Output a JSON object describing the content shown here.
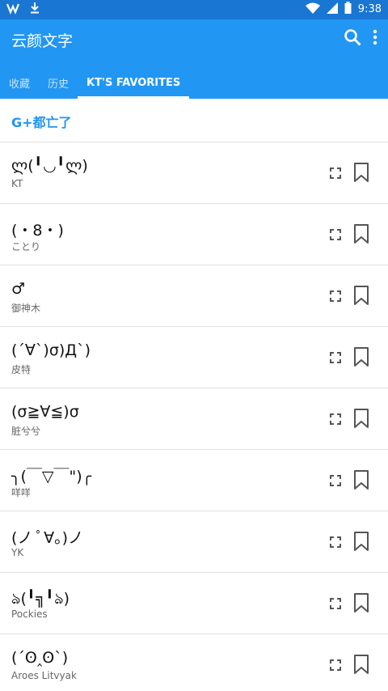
{
  "app": {
    "title": "云颜文字",
    "time": "9:38"
  },
  "tabs": [
    {
      "label": "收藏"
    },
    {
      "label": "历史"
    },
    {
      "label": "KT'S FAVORITES"
    }
  ],
  "section": {
    "header": "G+都亡了"
  },
  "items": [
    {
      "kaomoji": "ლ(╹◡╹ლ)",
      "author": "KT"
    },
    {
      "kaomoji": "(・8・)",
      "author": "ことり"
    },
    {
      "kaomoji": "♂",
      "author": "御神木"
    },
    {
      "kaomoji": "(´∀`)σ)Д`)",
      "author": "皮特"
    },
    {
      "kaomoji": "(σ≧∀≦)σ",
      "author": "脏兮兮"
    },
    {
      "kaomoji": "╮(￣▽￣\")╭",
      "author": "咩咩"
    },
    {
      "kaomoji": "(ノ ﾟ∀。)ノ",
      "author": "YK"
    },
    {
      "kaomoji": "ঌ(╹╗╹ঌ)",
      "author": "Pockies"
    },
    {
      "kaomoji": "(´ʘ‸ʘ`)",
      "author": "Aroes Litvyak"
    }
  ]
}
